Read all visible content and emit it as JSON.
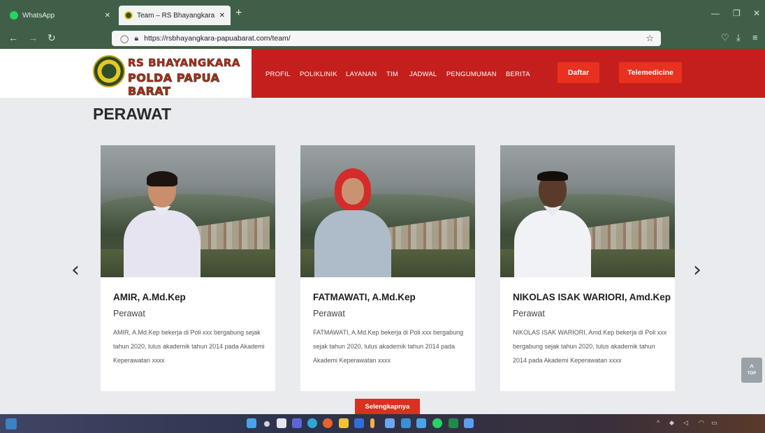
{
  "browser": {
    "tabs": [
      {
        "label": "WhatsApp",
        "active": false,
        "icon": "whatsapp-icon",
        "color": "#25d366"
      },
      {
        "label": "Team – RS Bhayangkara Tk. IV",
        "active": true,
        "icon": "site-favicon",
        "color": "#2f4e2a"
      }
    ],
    "new_tab": "+",
    "url": "https://rsbhayangkara-papuabarat.com/team/"
  },
  "site": {
    "logo_line1": "RS BHAYANGKARA",
    "logo_line2": "POLDA PAPUA BARAT",
    "nav": [
      "PROFIL",
      "POLIKLINIK",
      "LAYANAN",
      "TIM",
      "JADWAL",
      "PENGUMUMAN",
      "BERITA"
    ],
    "daftar": "Daftar",
    "telemedicine": "Telemedicine",
    "brand_red": "#c41f1c"
  },
  "section": {
    "title": "PERAWAT",
    "prev": "‹",
    "next": "›",
    "more": "Selengkapnya",
    "to_top": "TOP"
  },
  "cards": [
    {
      "name": "AMIR, A.Md.Kep",
      "role": "Perawat",
      "desc": "AMIR, A.Md.Kep bekerja di Poli xxx bergabung sejak tahun 2020, lulus akademik tahun 2014 pada Akademi Keperawatan xxxx"
    },
    {
      "name": "FATMAWATI, A.Md.Kep",
      "role": "Perawat",
      "desc": "FATMAWATI, A.Md.Kep bekerja di Poli xxx bergabung sejak tahun 2020, lulus akademik tahun 2014 pada Akademi Keperawatan xxxx"
    },
    {
      "name": "NIKOLAS ISAK WARIORI, Amd.Kep",
      "role": "Perawat",
      "desc": "NIKOLAS ISAK WARIORI, Amd.Kep bekerja di Poli xxx bergabung sejak tahun 2020, lulus akademik tahun 2014 pada Akademi Keperawatan xxxx"
    }
  ]
}
